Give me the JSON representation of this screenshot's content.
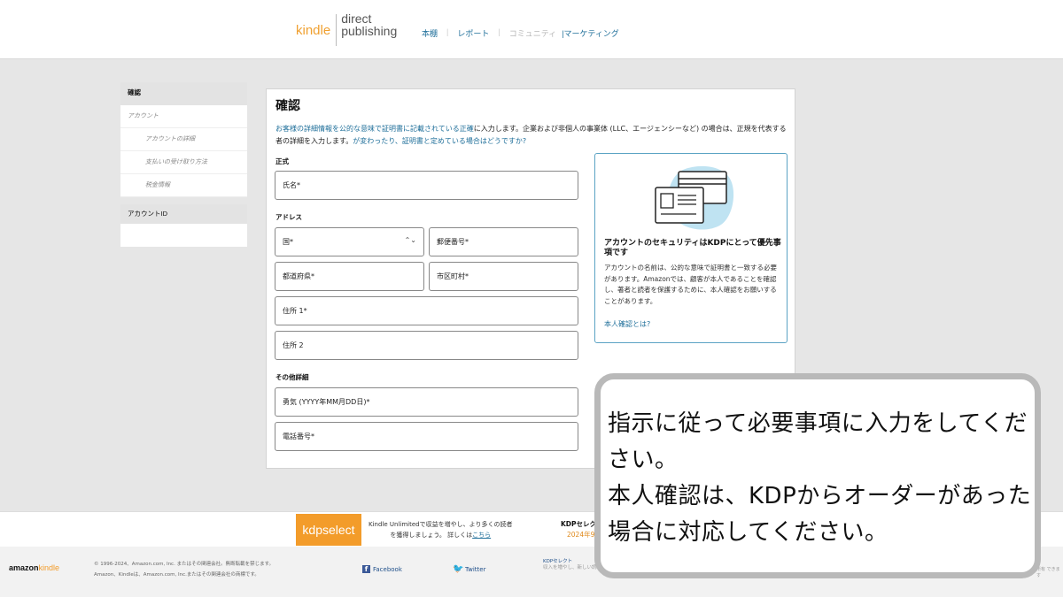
{
  "brand": {
    "kindle": "kindle",
    "direct": "direct",
    "publishing": "publishing"
  },
  "nav": {
    "bookshelf": "本棚",
    "reports": "レポート",
    "community": "コミュニティ",
    "marketing": "|マーケティング"
  },
  "sidebar": {
    "header": "確認",
    "items": [
      {
        "label": "アカウント"
      },
      {
        "label": "アカウントの詳細"
      },
      {
        "label": "支払いの受け取り方法"
      },
      {
        "label": "税金情報"
      }
    ],
    "account_id": "アカウントID"
  },
  "form": {
    "title": "確認",
    "intro_a": "お客様の詳細情報を公的な意味で証明書に記載されている正確",
    "intro_b": "に入力します。企業および非個人の事業体 (LLC、エージェンシーなど) の場合は、正規を代表する者の詳細を入力します。",
    "intro_link": "が変わったり、証明書と定めている場合はどうですか?",
    "section_official": "正式",
    "name_placeholder": "氏名*",
    "section_address": "アドレス",
    "country_placeholder": "国*",
    "postal_placeholder": "郵便番号*",
    "prefecture_placeholder": "都道府県*",
    "city_placeholder": "市区町村*",
    "address1_placeholder": "住所 1*",
    "address2_placeholder": "住所 2",
    "section_other": "その他詳細",
    "birthdate_placeholder": "勇気 (YYYY年MM月DD日)*",
    "phone_placeholder": "電話番号*"
  },
  "infobox": {
    "heading": "アカウントのセキュリティはKDPにとって優先事項です",
    "body": "アカウントの名前は、公的な意味で証明書と一致する必要があります。Amazonでは、顧客が本人であることを確認し、著者と読者を保護するために、本人確認をお願いすることがあります。",
    "link": "本人確認とは?"
  },
  "kdp_select": {
    "logo": "kdpselect",
    "line1": "Kindle Unlimitedで収益を増やし、より多くの読者",
    "line2": "を獲得しましょう。 詳しくは",
    "link": "こちら",
    "heading": "KDPセレク",
    "sub": "2024年9"
  },
  "footer": {
    "amazon": "amazon",
    "kindle": "kindle",
    "copyright": "© 1996-2024、Amazon.com, Inc. またはその関連会社。無断転載を禁じます。",
    "trademark": "Amazon、Kindleは、Amazon.com, Inc.またはその関連会社の商標です。",
    "facebook": "Facebook",
    "twitter": "Twitter",
    "kdp_select_label": "KDPセレクト",
    "kdp_select_desc": "収入を増やし、新しい読者",
    "tail": "所有 できます"
  },
  "callout": {
    "line1": "指示に従って必要事項に入力をしてください。",
    "line2": "本人確認は、KDPからオーダーがあった場合に対応してください。"
  },
  "colors": {
    "link": "#1f6f9a",
    "kindle_orange": "#f39c2a",
    "info_border": "#5ba3c4"
  }
}
